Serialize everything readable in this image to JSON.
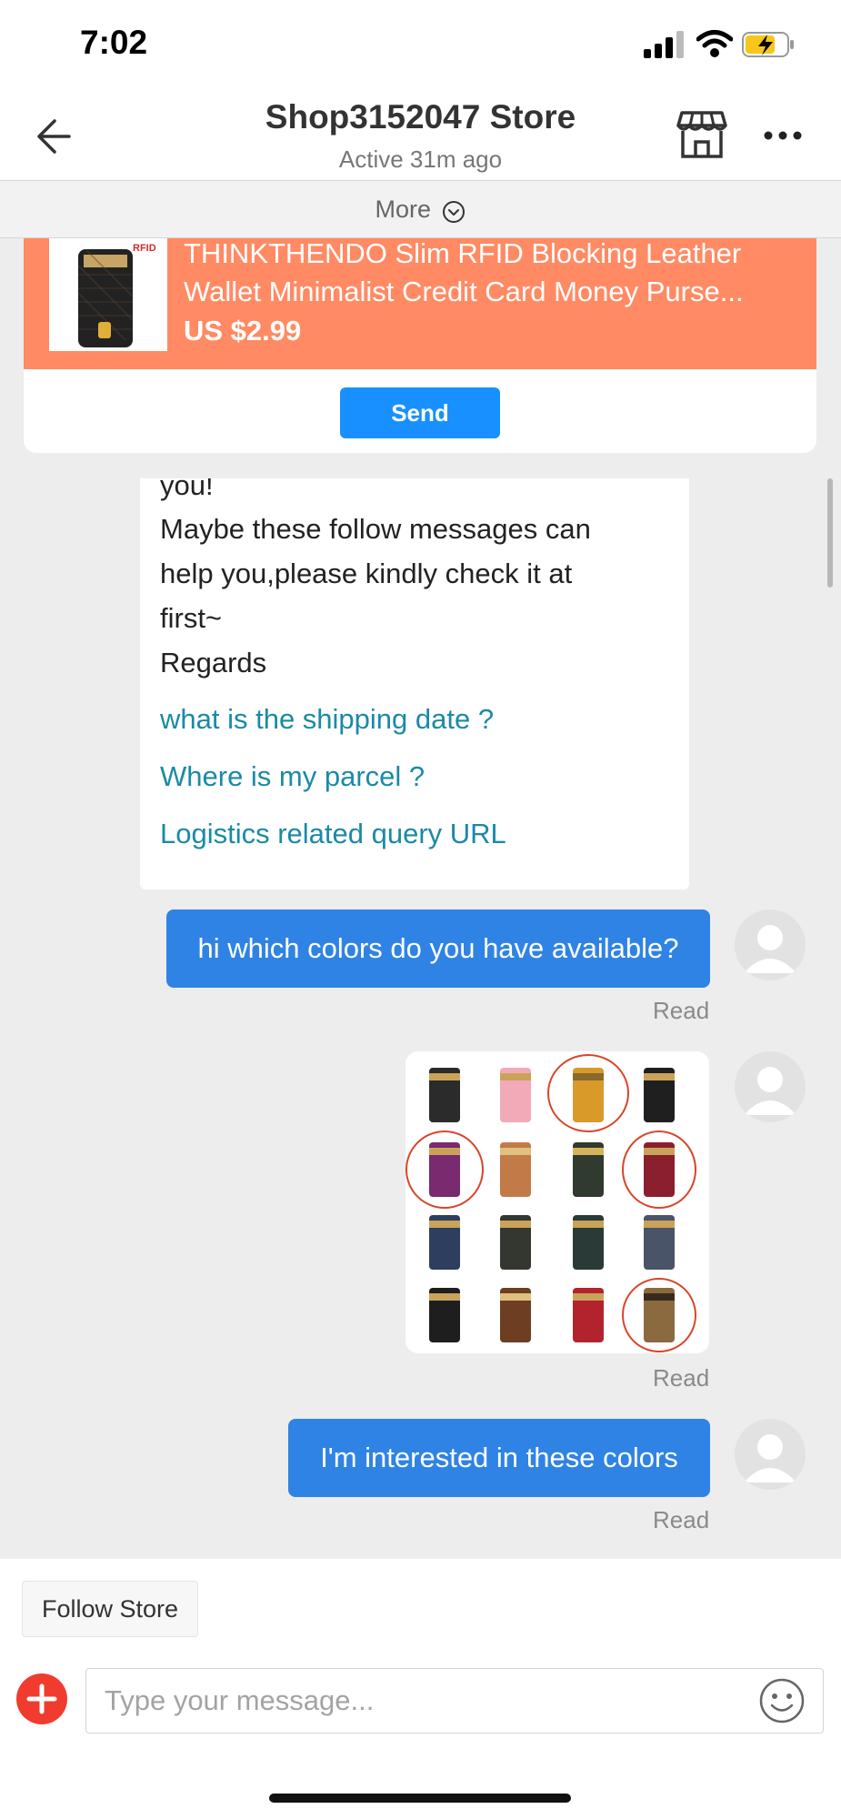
{
  "status_bar": {
    "time": "7:02"
  },
  "header": {
    "store_name": "Shop3152047 Store",
    "active_status": "Active 31m ago"
  },
  "more_bar": {
    "label": "More"
  },
  "product": {
    "thumb_label": "RFID",
    "name": "THINKTHENDO Slim RFID Blocking Leather Wallet Minimalist Credit Card Money Purse...",
    "price": "US $2.99",
    "send_label": "Send"
  },
  "chat": {
    "bot_message": {
      "lines": [
        "you!",
        "Maybe these follow messages can",
        "help you,please kindly check it at",
        "first~",
        "Regards"
      ],
      "links": [
        "what is the shipping date ?",
        "Where is my parcel ?",
        "Logistics related query URL"
      ]
    },
    "messages": [
      {
        "text": "hi which colors do you have available?",
        "status": "Read"
      },
      {
        "type": "image",
        "status": "Read"
      },
      {
        "text": "I'm interested in these colors",
        "status": "Read"
      }
    ]
  },
  "footer": {
    "follow_label": "Follow Store",
    "input_placeholder": "Type your message..."
  },
  "colors": {
    "accent_blue": "#1890ff",
    "user_bubble": "#2f83e4",
    "product_banner": "#ff8a63",
    "link_teal": "#1a8aa6",
    "plus_red": "#f03c2e"
  },
  "icons": [
    "back-arrow-icon",
    "store-icon",
    "more-dots-icon",
    "chevron-down-circle-icon",
    "plus-icon",
    "emoji-icon",
    "avatar-placeholder-icon"
  ]
}
